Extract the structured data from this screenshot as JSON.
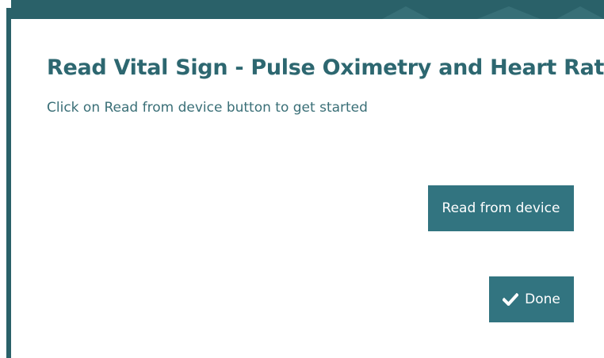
{
  "dialog": {
    "title": "Read Vital Sign - Pulse Oximetry and Heart Rate",
    "subtitle": "Click on Read from device button to get started",
    "read_button_label": "Read from device",
    "done_button_label": "Done"
  },
  "icons": {
    "done_icon": "check-icon"
  },
  "colors": {
    "accent": "#327480",
    "title": "#2d6770",
    "backdrop": "#2a6169"
  }
}
